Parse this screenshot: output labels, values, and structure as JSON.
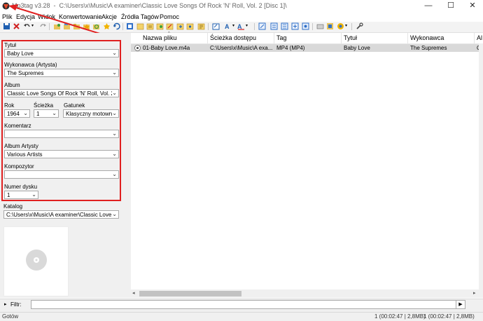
{
  "window": {
    "app_title": "Mp3tag v3.28",
    "path": "C:\\Users\\x\\Music\\A examiner\\Classic Love Songs Of Rock 'N' Roll, Vol. 2 [Disc 1]\\"
  },
  "menu": [
    "Plik",
    "Edycja",
    "Widok",
    "Konwertowanie",
    "Akcje",
    "Źródła Tagów",
    "Pomoc"
  ],
  "toolbar_icons": [
    "save-icon",
    "delete-icon",
    "undo-icon",
    "redo-icon",
    "change-dir-icon",
    "add-dir-icon",
    "folder-icon",
    "favorites-icon",
    "refresh-icon",
    "save-tag-icon",
    "folder-open-icon",
    "folder-add-icon",
    "folder-tree-icon",
    "playlist-icon",
    "tag-icon",
    "text-case-icon",
    "export-icon",
    "tag-filename-icon",
    "filename-tag-icon",
    "text-tag-icon",
    "tag-tag-icon",
    "freedb-icon",
    "globe-icon",
    "discogs-icon",
    "tools-icon"
  ],
  "tag_panel": {
    "title_label": "Tytuł",
    "title_value": "Baby Love",
    "artist_label": "Wykonawca (Artysta)",
    "artist_value": "The Supremes",
    "album_label": "Album",
    "album_value": "Classic Love Songs Of Rock 'N' Roll, Vol. 2 [Disc",
    "year_label": "Rok",
    "year_value": "1964",
    "track_label": "Ścieżka",
    "track_value": "1",
    "genre_label": "Gatunek",
    "genre_value": "Klasyczny motown",
    "comment_label": "Komentarz",
    "comment_value": "",
    "album_artist_label": "Album Artysty",
    "album_artist_value": "Various Artists",
    "composer_label": "Kompozytor",
    "composer_value": "",
    "disc_label": "Numer dysku",
    "disc_value": "1",
    "directory_label": "Katalog",
    "directory_value": "C:\\Users\\x\\Music\\A examiner\\Classic Love S"
  },
  "file_list": {
    "columns": [
      "Nazwa pliku",
      "Ścieżka dostępu",
      "Tag",
      "Tytuł",
      "Wykonawca",
      "Al"
    ],
    "rows": [
      [
        "01-Baby Love.m4a",
        "C:\\Users\\x\\Music\\A exa...",
        "MP4 (MP4)",
        "Baby Love",
        "The Supremes",
        "Cl"
      ]
    ]
  },
  "filter": {
    "label": "Filtr:",
    "value": ""
  },
  "status": {
    "left": "Gotów",
    "mid": "1 (00:02:47 | 2,8MB)",
    "right": "1 (00:02:47 | 2,8MB)"
  },
  "colors": {
    "highlight": "#e02020",
    "selected_row": "#d9d9d9",
    "panel": "#f0f0f0"
  }
}
